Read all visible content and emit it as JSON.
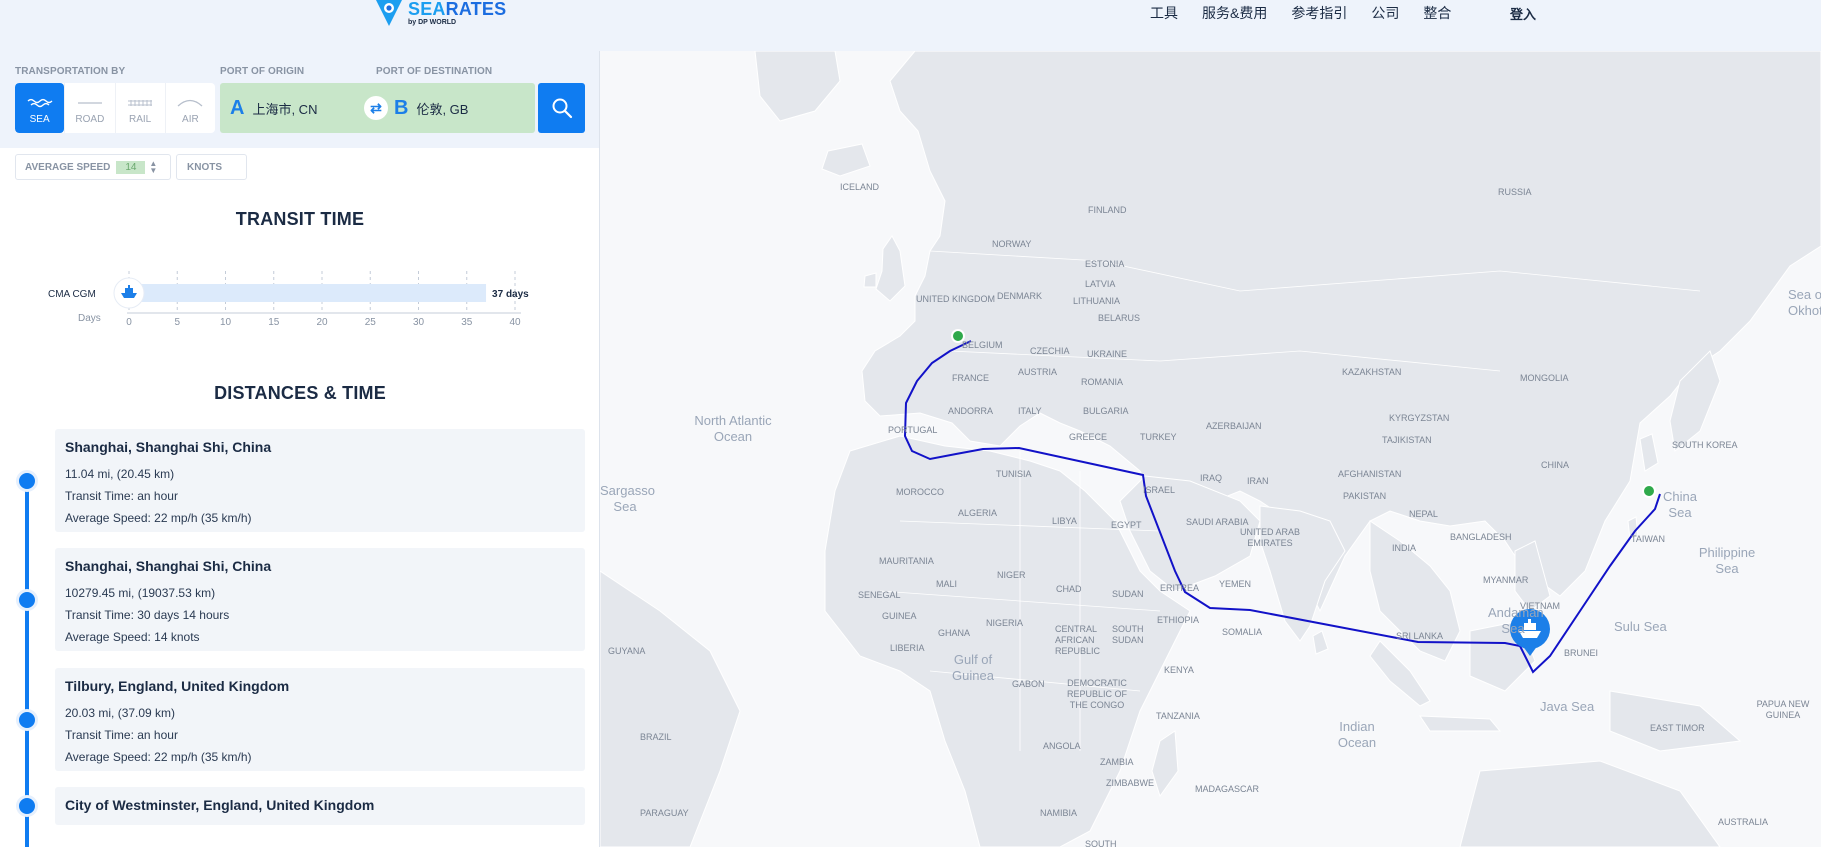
{
  "header": {
    "logo": {
      "name_accent": "SEA",
      "name_rest": "RATES",
      "sub": "by DP WORLD"
    },
    "nav": [
      "工具",
      "服务&费用",
      "参考指引",
      "公司",
      "整合"
    ],
    "login": "登入"
  },
  "search": {
    "transport_label": "TRANSPORTATION BY",
    "origin_label": "PORT OF ORIGIN",
    "destination_label": "PORT OF DESTINATION",
    "modes": [
      {
        "label": "SEA",
        "icon": "waves-icon",
        "active": true
      },
      {
        "label": "ROAD",
        "icon": "road-icon",
        "active": false
      },
      {
        "label": "RAIL",
        "icon": "rail-icon",
        "active": false
      },
      {
        "label": "AIR",
        "icon": "plane-icon",
        "active": false
      }
    ],
    "origin": {
      "letter": "A",
      "value": "上海市, CN"
    },
    "destination": {
      "letter": "B",
      "value": "伦敦, GB"
    },
    "swap_symbol": "⇄"
  },
  "speed": {
    "label": "AVERAGE SPEED",
    "value": "14",
    "unit": "KNOTS"
  },
  "transit": {
    "title": "TRANSIT TIME",
    "carrier": "CMA CGM",
    "days_label": "Days",
    "result": "37 days",
    "days": 37,
    "axis_max": 40,
    "ticks": [
      "0",
      "5",
      "10",
      "15",
      "20",
      "25",
      "30",
      "35",
      "40"
    ]
  },
  "distances": {
    "title": "DISTANCES & TIME",
    "legs": [
      {
        "title": "Shanghai, Shanghai Shi, China",
        "distance": "11.04 mi, (20.45 km)",
        "time": "Transit Time: an hour",
        "speed": "Average Speed: 22 mp/h (35 km/h)"
      },
      {
        "title": "Shanghai, Shanghai Shi, China",
        "distance": "10279.45 mi, (19037.53 km)",
        "time": "Transit Time: 30 days 14 hours",
        "speed": "Average Speed: 14 knots"
      },
      {
        "title": "Tilbury, England, United Kingdom",
        "distance": "20.03 mi, (37.09 km)",
        "time": "Transit Time: an hour",
        "speed": "Average Speed: 22 mp/h (35 km/h)"
      },
      {
        "title": "City of Westminster, England, United Kingdom"
      }
    ]
  },
  "map": {
    "route_color": "#1212c8",
    "countries": [
      "ICELAND",
      "FINLAND",
      "RUSSIA",
      "NORWAY",
      "ESTONIA",
      "LATVIA",
      "LITHUANIA",
      "DENMARK",
      "UNITED KINGDOM",
      "BELARUS",
      "BELGIUM",
      "CZECHIA",
      "UKRAINE",
      "FRANCE",
      "AUSTRIA",
      "ROMANIA",
      "KAZAKHSTAN",
      "MONGOLIA",
      "ANDORRA",
      "ITALY",
      "BULGARIA",
      "PORTUGAL",
      "GREECE",
      "TURKEY",
      "AZERBAIJAN",
      "KYRGYZSTAN",
      "TAJIKISTAN",
      "SOUTH KOREA",
      "CHINA",
      "TUNISIA",
      "IRAQ",
      "IRAN",
      "AFGHANISTAN",
      "MOROCCO",
      "ISRAEL",
      "PAKISTAN",
      "ALGERIA",
      "LIBYA",
      "EGYPT",
      "SAUDI ARABIA",
      "NEPAL",
      "BANGLADESH",
      "UNITED ARAB EMIRATES",
      "INDIA",
      "TAIWAN",
      "MAURITANIA",
      "NIGER",
      "MALI",
      "YEMEN",
      "MYANMAR",
      "SENEGAL",
      "CHAD",
      "SUDAN",
      "ERITREA",
      "GUINEA",
      "ETHIOPIA",
      "NIGERIA",
      "GHANA",
      "VIETNAM",
      "LIBERIA",
      "CENTRAL AFRICAN REPUBLIC",
      "SOUTH SUDAN",
      "SOMALIA",
      "SRI LANKA",
      "BRUNEI",
      "GUYANA",
      "GABON",
      "DEMOCRATIC REPUBLIC OF THE CONGO",
      "KENYA",
      "EAST TIMOR",
      "PAPUA NEW GUINEA",
      "TANZANIA",
      "BRAZIL",
      "ANGOLA",
      "ZAMBIA",
      "ZIMBABWE",
      "MADAGASCAR",
      "NAMIBIA",
      "PARAGUAY",
      "SOUTH",
      "AUSTRALIA"
    ],
    "oceans": [
      "North Atlantic Ocean",
      "Sargasso Sea",
      "Gulf of Guinea",
      "Indian Ocean",
      "Andaman Sea",
      "Java Sea",
      "Sulu Sea",
      "Philippine Sea",
      "China Sea",
      "Sea of Okhotsk"
    ]
  }
}
